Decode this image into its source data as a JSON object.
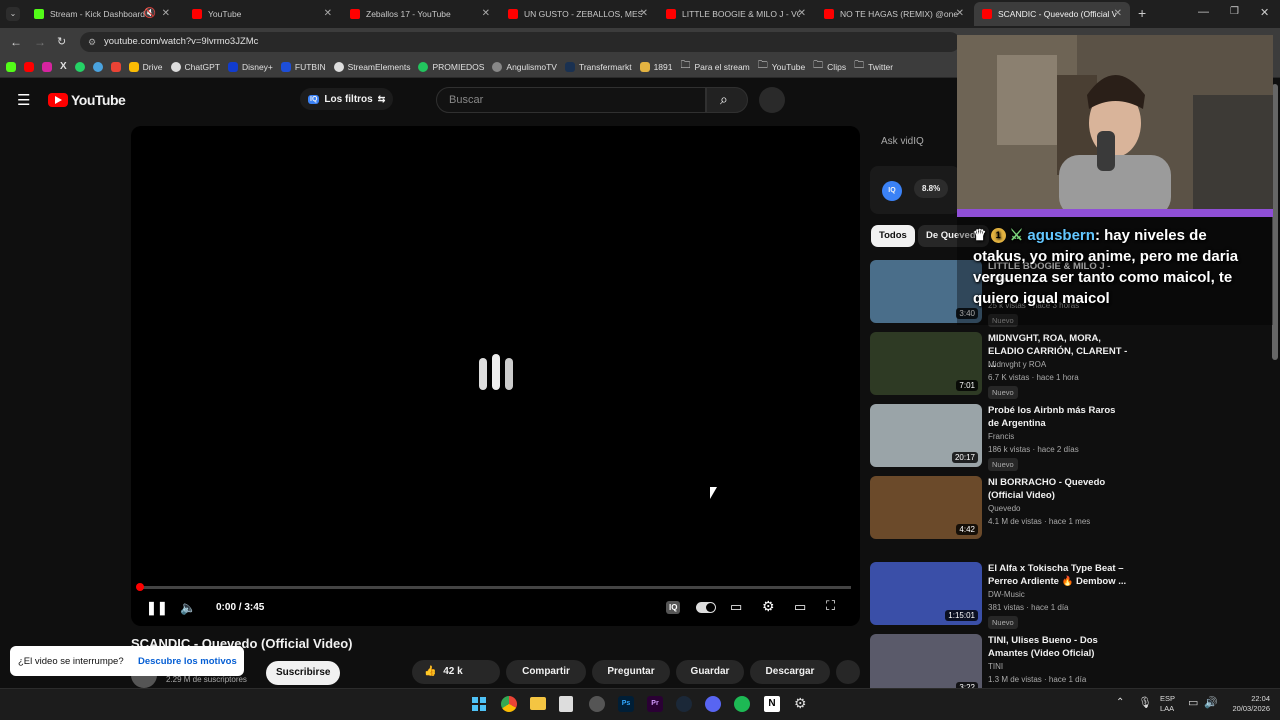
{
  "browser": {
    "tabs": [
      {
        "label": "Stream - Kick Dashboard",
        "color": "#53fc18"
      },
      {
        "label": "YouTube",
        "color": "#ff0000"
      },
      {
        "label": "Zeballos 17 - YouTube",
        "color": "#ff0000"
      },
      {
        "label": "UN GUSTO - ZEBALLOS, MESITA",
        "color": "#ff0000"
      },
      {
        "label": "LITTLE BOOGIE & MILO J - VOY",
        "color": "#ff0000"
      },
      {
        "label": "NO TE HAGAS (REMIX) @oney",
        "color": "#ff0000"
      },
      {
        "label": "SCANDIC - Quevedo (Official V",
        "color": "#ff0000"
      }
    ],
    "url": "youtube.com/watch?v=9lvrmo3JZMc",
    "bookmarks": [
      "Drive",
      "ChatGPT",
      "Disney+",
      "FUTBIN",
      "StreamElements",
      "PROMIEDOS",
      "AngulismoTV",
      "Transfermarkt",
      "1891",
      "Para el stream",
      "YouTube",
      "Clips",
      "Twitter"
    ]
  },
  "youtube": {
    "logo": "YouTube",
    "filters_label": "Los filtros",
    "filters_badge": "IQ",
    "search_placeholder": "Buscar",
    "ask_placeholder": "Ask vidIQ",
    "vidiq_score": "8.8%",
    "vidiq_badge": "IQ"
  },
  "player": {
    "time": "0:00 / 3:45",
    "progress": 0.0,
    "iq_label": "IQ"
  },
  "video": {
    "title": "SCANDIC - Quevedo (Official Video)",
    "subscribers": "2.29 M de suscriptores",
    "subscribe": "Suscribirse",
    "likes": "42 k",
    "share": "Compartir",
    "ask": "Preguntar",
    "save": "Guardar",
    "download": "Descargar"
  },
  "toast": {
    "question": "¿El video se interrumpe?",
    "link": "Descubre los motivos"
  },
  "chips": [
    "Todos",
    "De Quevedo"
  ],
  "recommendations": [
    {
      "title": "LITTLE BOOGIE & MILO J - VOY",
      "channel": "",
      "meta": "25 k vistas · hace 3 horas",
      "badge": "Nuevo",
      "duration": "3:40",
      "thumb": "#4a6e8a"
    },
    {
      "title": "MIDNVGHT, ROA, MORA, ELADIO CARRIÓN, CLARENT - ...",
      "channel": "Midnvght y ROA",
      "meta": "6.7 K vistas · hace 1 hora",
      "badge": "Nuevo",
      "duration": "7:01",
      "thumb": "#2e3a24"
    },
    {
      "title": "Probé los Airbnb más Raros de Argentina",
      "channel": "Francis",
      "meta": "186 k vistas · hace 2 días",
      "badge": "Nuevo",
      "duration": "20:17",
      "thumb": "#9aa4a8"
    },
    {
      "title": "NI BORRACHO - Quevedo (Official Video)",
      "channel": "Quevedo",
      "meta": "4.1 M de vistas · hace 1 mes",
      "badge": "",
      "duration": "4:42",
      "thumb": "#6b4a2a"
    },
    {
      "title": "El Alfa x Tokischa Type Beat – Perreo Ardiente 🔥 Dembow ...",
      "channel": "DW-Music",
      "meta": "381 vistas · hace 1 día",
      "badge": "Nuevo",
      "duration": "1:15:01",
      "thumb": "#3a4fa8"
    },
    {
      "title": "TINI, Ulises Bueno - Dos Amantes (Video Oficial)",
      "channel": "TINI",
      "meta": "1.3 M de vistas · hace 1 día",
      "badge": "",
      "duration": "3:22",
      "thumb": "#5a5a6a"
    }
  ],
  "overlay": {
    "username": "agusbern",
    "badge_count": "1",
    "message": "hay niveles de otakus, yo miro anime, pero me daria verguenza ser tanto como maicol, te quiero igual maicol"
  },
  "taskbar": {
    "lang": "ESP",
    "layout": "LAA",
    "time": "22:04",
    "date": "20/03/2026"
  }
}
